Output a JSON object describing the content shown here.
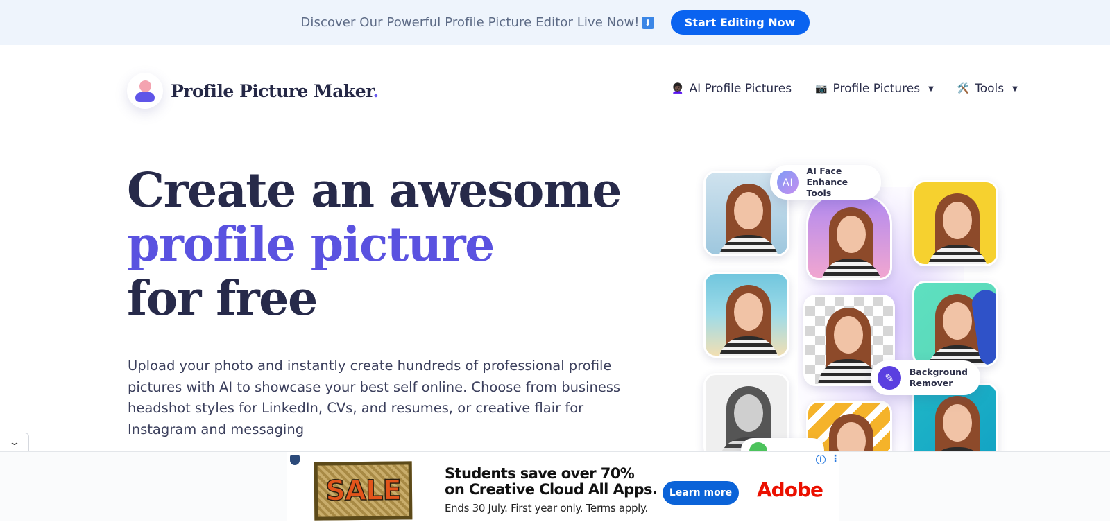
{
  "banner": {
    "text": "Discover Our Powerful Profile Picture Editor Live Now!",
    "arrow_icon": "⬇",
    "cta_label": "Start Editing Now"
  },
  "header": {
    "logo_text": "Profile Picture Maker",
    "logo_dot": ".",
    "nav": [
      {
        "icon": "👩🏿‍🦱",
        "label": "AI Profile Pictures",
        "dropdown": false
      },
      {
        "icon": "📷",
        "label": "Profile Pictures",
        "dropdown": true
      },
      {
        "icon": "🛠️",
        "label": "Tools",
        "dropdown": true
      }
    ],
    "caret": "▼"
  },
  "hero": {
    "title_line1": "Create an awesome",
    "title_line2": "profile picture",
    "title_line3": "for free",
    "description": "Upload your photo and instantly create hundreds of professional profile pictures with AI to showcase your best self online. Choose from business headshot styles for LinkedIn, CVs, and resumes, or creative flair for Instagram and messaging"
  },
  "collage": {
    "chip_ai_badge": "AI",
    "chip_ai_label_1": "AI Face",
    "chip_ai_label_2": "Enhance Tools",
    "chip_bg_icon": "✎",
    "chip_bg_label_1": "Background",
    "chip_bg_label_2": "Remover"
  },
  "collapse_icon": "⌄",
  "ad": {
    "sale_text": "SALE",
    "headline_1": "Students save over 70%",
    "headline_2": "on Creative Cloud All Apps.",
    "sub": "Ends 30 July. First year only. Terms apply.",
    "button": "Learn more",
    "brand": "Adobe",
    "info_icon": "i",
    "more_icon": "⋮"
  },
  "colors": {
    "accent": "#5a52e0",
    "cta_blue": "#0a63f0",
    "banner_bg": "#eef4fc",
    "adobe_red": "#eb1000"
  }
}
